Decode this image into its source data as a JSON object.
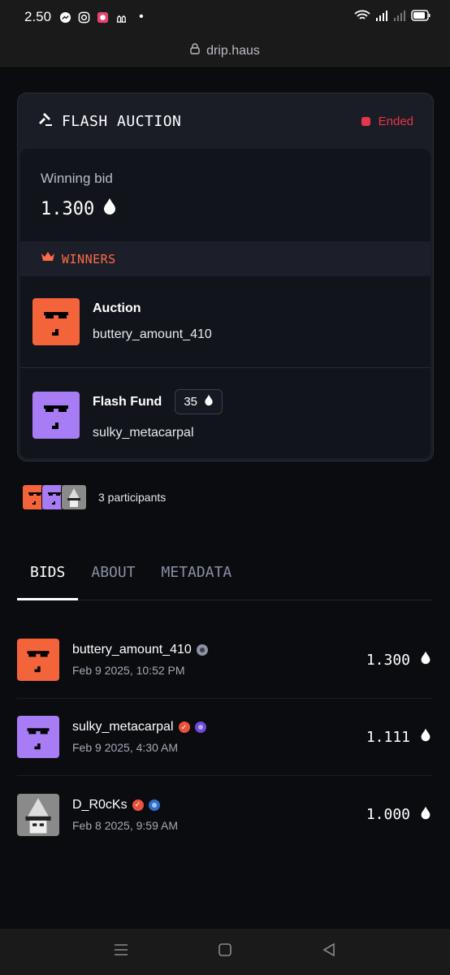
{
  "status": {
    "time": "2.50",
    "dot": "•"
  },
  "url": {
    "text": "drip.haus"
  },
  "auction": {
    "title": "FLASH AUCTION",
    "status": "Ended",
    "status_color": "#e5364b",
    "winning_bid_label": "Winning bid",
    "winning_bid_value": "1.300",
    "winners_label": "WINNERS",
    "winners": [
      {
        "name": "Auction",
        "user": "buttery_amount_410",
        "avatar_color": "#f4643a"
      },
      {
        "name": "Flash Fund",
        "user": "sulky_metacarpal",
        "amount": "35",
        "avatar_color": "#a77cf4"
      }
    ]
  },
  "participants": {
    "label": "3 participants"
  },
  "tabs": [
    {
      "label": "BIDS",
      "active": true
    },
    {
      "label": "ABOUT",
      "active": false
    },
    {
      "label": "METADATA",
      "active": false
    }
  ],
  "bids": [
    {
      "user": "buttery_amount_410",
      "date": "Feb 9 2025, 10:52 PM",
      "amount": "1.300",
      "avatar_color": "#f4643a"
    },
    {
      "user": "sulky_metacarpal",
      "date": "Feb 9 2025, 4:30 AM",
      "amount": "1.111",
      "avatar_color": "#a77cf4"
    },
    {
      "user": "D_R0cKs",
      "date": "Feb 8 2025, 9:59 AM",
      "amount": "1.000",
      "avatar_color": "#8a8a8a"
    }
  ]
}
